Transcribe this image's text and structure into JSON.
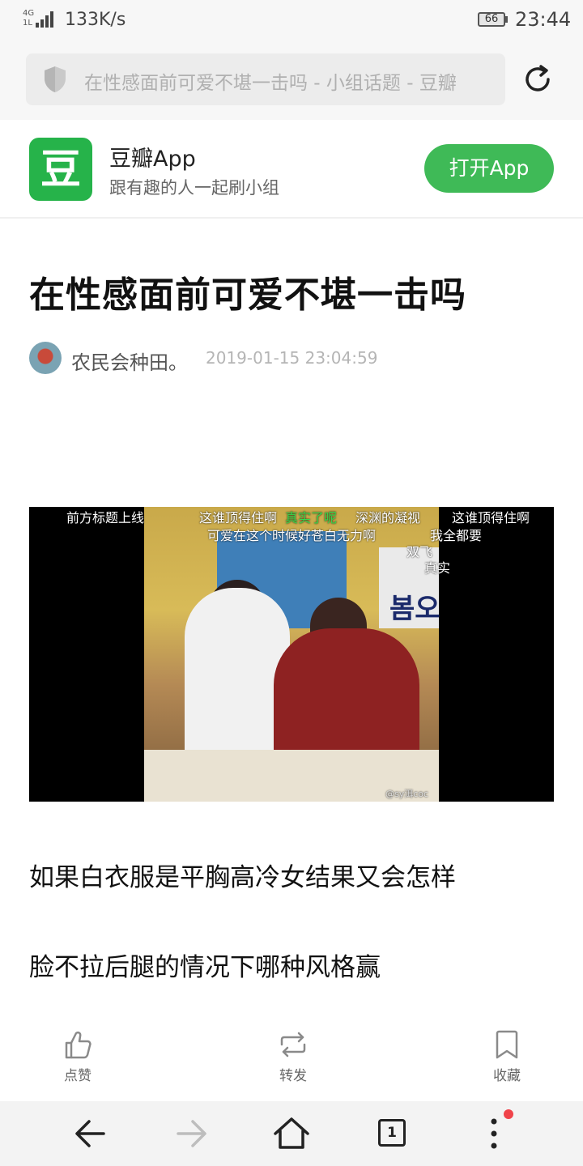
{
  "status_bar": {
    "network_tag_top": "4G",
    "network_tag_bottom": "1L",
    "net_speed": "133K/s",
    "battery": "66",
    "time": "23:44"
  },
  "url_bar": {
    "text": "在性感面前可爱不堪一击吗 - 小组话题 - 豆瓣",
    "icons": [
      "shield-icon",
      "reload-icon"
    ]
  },
  "app_banner": {
    "logo_char": "豆",
    "name": "豆瓣App",
    "subtitle": "跟有趣的人一起刷小组",
    "open_button": "打开App",
    "accent": "#3fba57"
  },
  "article": {
    "title": "在性感面前可爱不堪一击吗",
    "author": "农民会种田。",
    "date": "2019-01-15 23:04:59",
    "image_overlay_text": [
      "前方标题上线",
      "这谁顶得住啊",
      "真实了呢",
      "深渊的凝视",
      "这谁顶得住啊",
      "可爱在这个时候好苍白无力啊",
      "我全都要",
      "双飞",
      "真实",
      "봄오",
      "@sy洱coc"
    ],
    "paragraphs": [
      "如果白衣服是平胸高冷女结果又会怎样",
      "脸不拉后腿的情况下哪种风格赢"
    ]
  },
  "actions": {
    "like": "点赞",
    "share": "转发",
    "collect": "收藏"
  },
  "bottom_nav": {
    "tab_count": "1",
    "icons": [
      "back-arrow-icon",
      "forward-arrow-icon",
      "home-icon",
      "tabs-icon",
      "more-icon"
    ]
  }
}
